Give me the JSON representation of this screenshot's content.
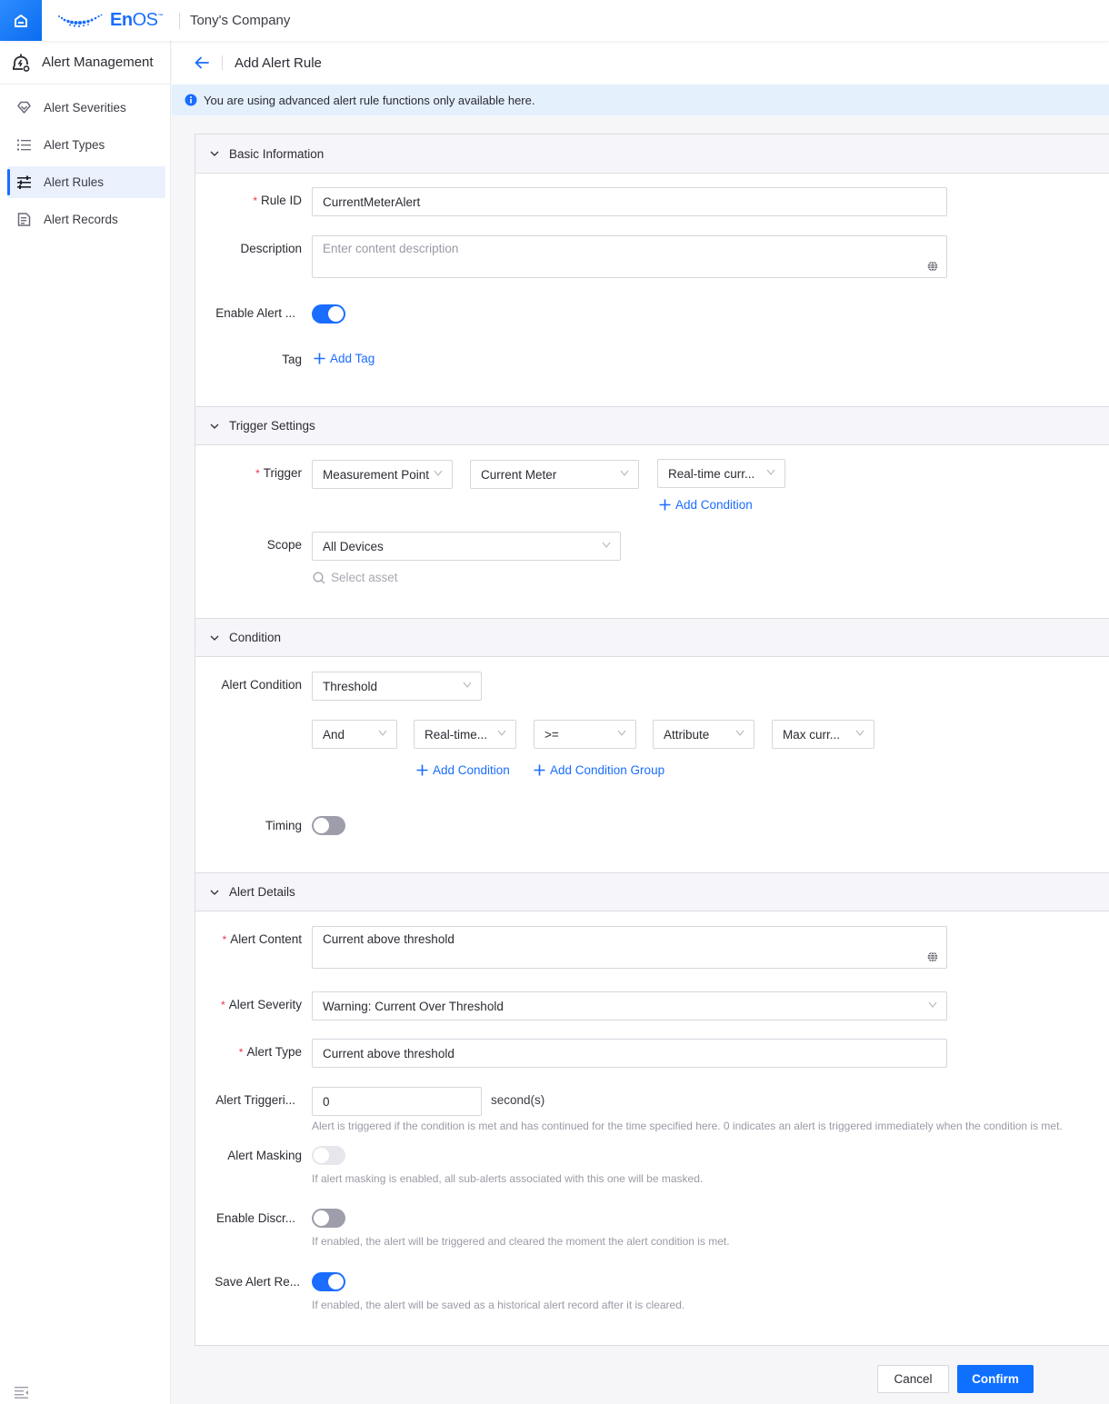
{
  "topbar": {
    "logo_text_bold": "En",
    "logo_text_light": "OS",
    "logo_tm": "™",
    "company": "Tony's Company"
  },
  "sidebar": {
    "title": "Alert Management",
    "items": [
      {
        "label": "Alert Severities",
        "icon": "diamond-icon",
        "active": false
      },
      {
        "label": "Alert Types",
        "icon": "list-icon",
        "active": false
      },
      {
        "label": "Alert Rules",
        "icon": "sliders-icon",
        "active": true
      },
      {
        "label": "Alert Records",
        "icon": "document-icon",
        "active": false
      }
    ]
  },
  "header": {
    "title": "Add Alert Rule"
  },
  "notice": {
    "text": "You are using advanced alert rule functions only available here."
  },
  "sections": {
    "basic": {
      "title": "Basic Information",
      "rule_id_label": "Rule ID",
      "rule_id_value": "CurrentMeterAlert",
      "description_label": "Description",
      "description_placeholder": "Enter content description",
      "enable_label": "Enable Alert ...",
      "enable_on": true,
      "tag_label": "Tag",
      "add_tag": "Add Tag"
    },
    "trigger": {
      "title": "Trigger Settings",
      "trigger_label": "Trigger",
      "trigger_type": "Measurement Point",
      "trigger_model": "Current Meter",
      "trigger_point": "Real-time curr...",
      "add_condition": "Add Condition",
      "scope_label": "Scope",
      "scope_value": "All Devices",
      "select_asset": "Select asset"
    },
    "condition": {
      "title": "Condition",
      "alert_condition_label": "Alert Condition",
      "alert_condition_value": "Threshold",
      "logic": "And",
      "left_operand": "Real-time...",
      "operator": ">=",
      "right_type": "Attribute",
      "right_operand": "Max curr...",
      "add_condition": "Add Condition",
      "add_condition_group": "Add Condition Group",
      "timing_label": "Timing",
      "timing_on": false
    },
    "details": {
      "title": "Alert Details",
      "content_label": "Alert Content",
      "content_value": "Current above threshold",
      "severity_label": "Alert Severity",
      "severity_value": "Warning: Current Over Threshold",
      "type_label": "Alert Type",
      "type_value": "Current above threshold",
      "triggering_label": "Alert Triggeri...",
      "triggering_value": "0",
      "triggering_unit": "second(s)",
      "triggering_hint": "Alert is triggered if the condition is met and has continued for the time specified here. 0 indicates an alert is triggered immediately when the condition is met.",
      "masking_label": "Alert Masking",
      "masking_on": false,
      "masking_disabled": true,
      "masking_hint": "If alert masking is enabled, all sub-alerts associated with this one will be masked.",
      "discrete_label": "Enable Discr...",
      "discrete_on": false,
      "discrete_hint": "If enabled, the alert will be triggered and cleared the moment the alert condition is met.",
      "save_label": "Save Alert Re...",
      "save_on": true,
      "save_hint": "If enabled, the alert will be saved as a historical alert record after it is cleared."
    }
  },
  "footer": {
    "cancel": "Cancel",
    "confirm": "Confirm"
  },
  "colors": {
    "accent": "#1a6dff",
    "required": "#e8374a",
    "notice_bg": "#e5f0fd"
  }
}
